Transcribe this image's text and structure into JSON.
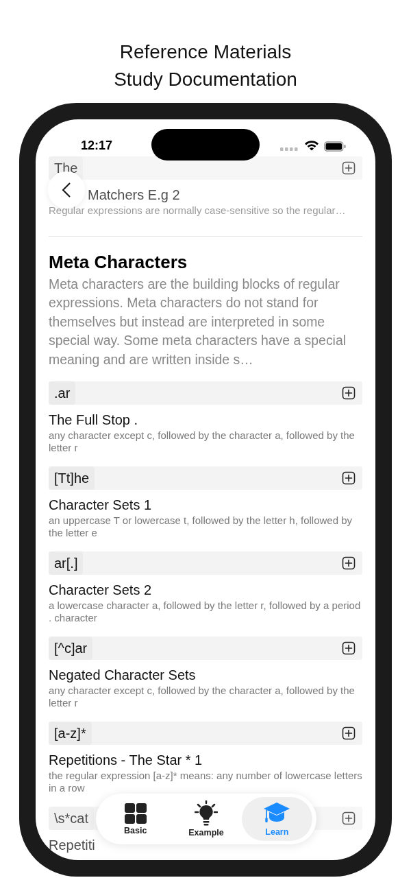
{
  "header": {
    "lines": [
      "Reference Materials",
      "Study Documentation"
    ]
  },
  "status_bar": {
    "time": "12:17"
  },
  "faded_top": {
    "code": "The",
    "title": "Matchers E.g  2",
    "description": "Regular expressions are normally case-sensitive so the regular…"
  },
  "section": {
    "title": "Meta Characters",
    "description": "Meta characters are the building blocks of regular expressions. Meta characters do not stand for themselves but instead are interpreted in some special way. Some meta characters have a special meaning and are written inside s…"
  },
  "items": [
    {
      "code": ".ar",
      "title": "The Full Stop .",
      "description": "any character except c, followed by the character a, followed by the letter r"
    },
    {
      "code": "[Tt]he",
      "title": "Character Sets 1",
      "description": "an uppercase T or lowercase t, followed by the letter h, followed by the letter e"
    },
    {
      "code": "ar[.]",
      "title": "Character Sets 2",
      "description": "a lowercase character a, followed by the letter r, followed by a period . character"
    },
    {
      "code": "[^c]ar",
      "title": "Negated Character Sets",
      "description": "any character except c, followed by the character a, followed by the letter r"
    },
    {
      "code": "[a-z]*",
      "title": "Repetitions - The Star * 1",
      "description": "the regular expression [a-z]* means: any number of lowercase letters in a row"
    }
  ],
  "faded_bottom": {
    "code": "\\s*cat",
    "title": "Repetiti"
  },
  "tabs": [
    {
      "label": "Basic",
      "kind": "grid",
      "selected": false
    },
    {
      "label": "Example",
      "kind": "bulb",
      "selected": false
    },
    {
      "label": "Learn",
      "kind": "cap",
      "selected": true
    }
  ]
}
